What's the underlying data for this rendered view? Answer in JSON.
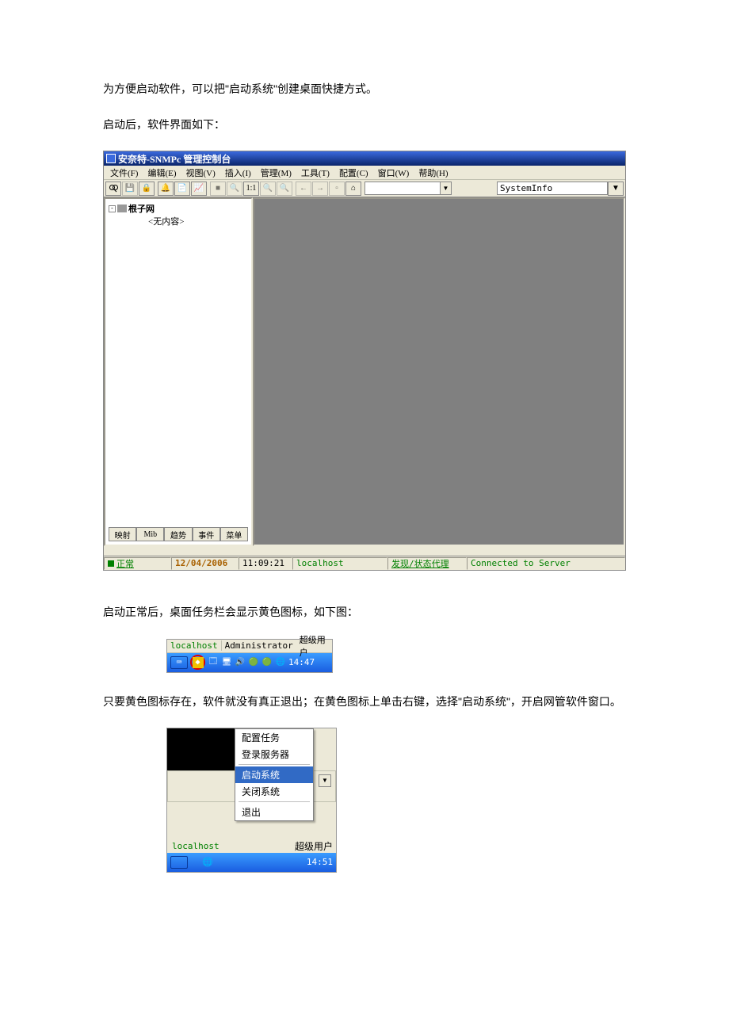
{
  "doc": {
    "para1": "为方便启动软件，可以把\"启动系统\"创建桌面快捷方式。",
    "para2": "启动后，软件界面如下：",
    "para3": "启动正常后，桌面任务栏会显示黄色图标，如下图：",
    "para4": "只要黄色图标存在，软件就没有真正退出；在黄色图标上单击右键，选择\"启动系统\"，开启网管软件窗口。"
  },
  "app": {
    "title": "安奈特-SNMPc 管理控制台",
    "menu": {
      "file": "文件(F)",
      "edit": "编辑(E)",
      "view": "视图(V)",
      "insert": "插入(I)",
      "manage": "管理(M)",
      "tools": "工具(T)",
      "config": "配置(C)",
      "window": "窗口(W)",
      "help": "帮助(H)"
    },
    "toolbar": {
      "ratio": "1:1",
      "combo": "SystemInfo"
    },
    "tree": {
      "root": "根子网",
      "empty": "<无内容>"
    },
    "tabs": {
      "map": "映射",
      "mib": "Mib",
      "trend": "趋势",
      "event": "事件",
      "menu": "菜单"
    },
    "status": {
      "normal": "正常",
      "date": "12/04/2006",
      "time": "11:09:21",
      "host": "localhost",
      "agent": "发现/状态代理",
      "conn": "Connected to Server"
    }
  },
  "tray": {
    "host": "localhost",
    "user": "Administrator",
    "role": "超级用户",
    "time": "14:47"
  },
  "ctxmenu": {
    "cfg": "配置任务",
    "login": "登录服务器",
    "start": "启动系统",
    "stop": "关闭系统",
    "exit": "退出",
    "host": "localhost",
    "role": "超级用户",
    "time": "14:51"
  }
}
